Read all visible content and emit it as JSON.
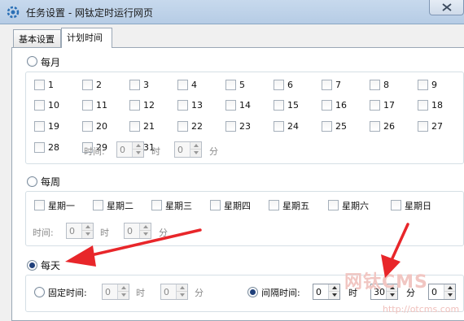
{
  "window": {
    "title": "任务设置 - 网钛定时运行网页"
  },
  "tabs": [
    {
      "label": "基本设置",
      "active": false
    },
    {
      "label": "计划时间",
      "active": true
    }
  ],
  "monthly": {
    "label": "每月",
    "selected": false,
    "days": [
      "1",
      "2",
      "3",
      "4",
      "5",
      "6",
      "7",
      "8",
      "9",
      "10",
      "11",
      "12",
      "13",
      "14",
      "15",
      "16",
      "17",
      "18",
      "19",
      "20",
      "21",
      "22",
      "23",
      "24",
      "25",
      "26",
      "27",
      "28",
      "29",
      "31"
    ],
    "time_label": "时间:",
    "hour_value": "0",
    "hour_unit": "时",
    "minute_value": "0",
    "minute_unit": "分"
  },
  "weekly": {
    "label": "每周",
    "selected": false,
    "days": [
      "星期一",
      "星期二",
      "星期三",
      "星期四",
      "星期五",
      "星期六",
      "星期日"
    ],
    "time_label": "时间:",
    "hour_value": "0",
    "hour_unit": "时",
    "minute_value": "0",
    "minute_unit": "分"
  },
  "daily": {
    "label": "每天",
    "selected": true,
    "fixed": {
      "label": "固定时间:",
      "selected": false,
      "hour_value": "0",
      "hour_unit": "时",
      "minute_value": "0",
      "minute_unit": "分"
    },
    "interval": {
      "label": "间隔时间:",
      "selected": true,
      "hour_value": "0",
      "hour_unit": "时",
      "minute_value": "30",
      "minute_unit": "分",
      "second_value": "0"
    }
  },
  "watermark": {
    "brand": "网钛CMS",
    "url": "http://otcms.com"
  },
  "colors": {
    "annotation_arrow": "#e8262a",
    "title_bar": "#c7d9ed"
  }
}
